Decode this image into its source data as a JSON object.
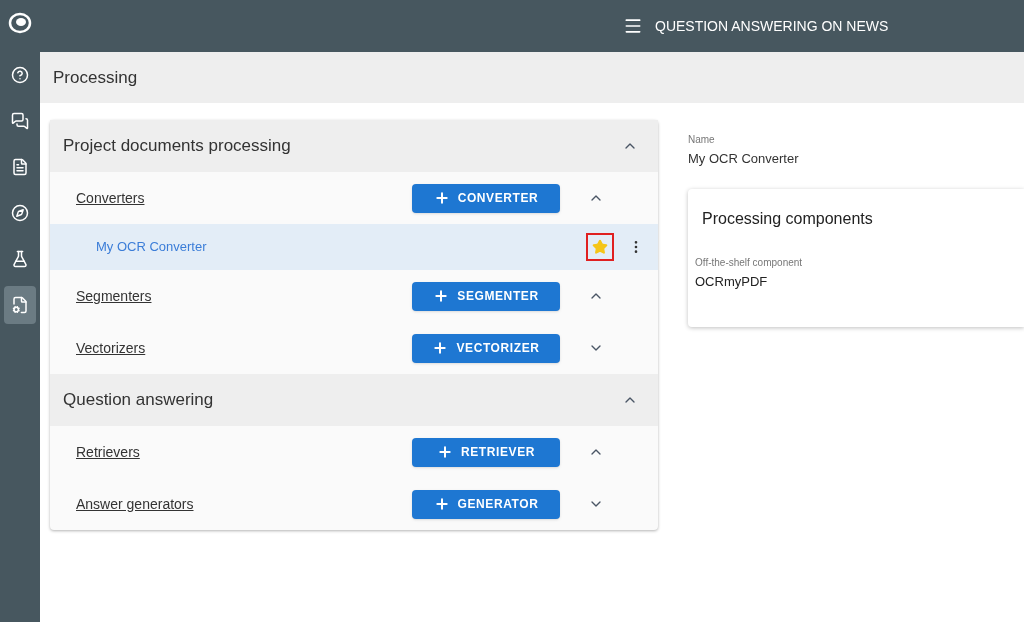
{
  "top_bar": {
    "title": "QUESTION ANSWERING ON NEWS"
  },
  "sidebar": {
    "items": [
      {
        "kind": "question",
        "selected": false
      },
      {
        "kind": "chat",
        "selected": false
      },
      {
        "kind": "documents",
        "selected": false
      },
      {
        "kind": "compass",
        "selected": false
      },
      {
        "kind": "flask",
        "selected": false
      },
      {
        "kind": "file-settings",
        "selected": true
      }
    ]
  },
  "page_header": {
    "title": "Processing"
  },
  "sections": [
    {
      "title": "Project documents processing",
      "expanded": true,
      "groups": [
        {
          "title": "Converters",
          "button": "CONVERTER",
          "expanded": true,
          "items": [
            {
              "name": "My OCR Converter",
              "selected": true,
              "starred": true,
              "highlighted": true
            }
          ]
        },
        {
          "title": "Segmenters",
          "button": "SEGMENTER",
          "expanded": true
        },
        {
          "title": "Vectorizers",
          "button": "VECTORIZER",
          "expanded": false
        }
      ]
    },
    {
      "title": "Question answering",
      "expanded": true,
      "groups": [
        {
          "title": "Retrievers",
          "button": "RETRIEVER",
          "expanded": true
        },
        {
          "title": "Answer generators",
          "button": "GENERATOR",
          "expanded": false
        }
      ]
    }
  ],
  "details": {
    "name_label": "Name",
    "name_value": "My OCR Converter",
    "card_title": "Processing components",
    "component_label": "Off-the-shelf component",
    "component_value": "OCRmyPDF"
  }
}
